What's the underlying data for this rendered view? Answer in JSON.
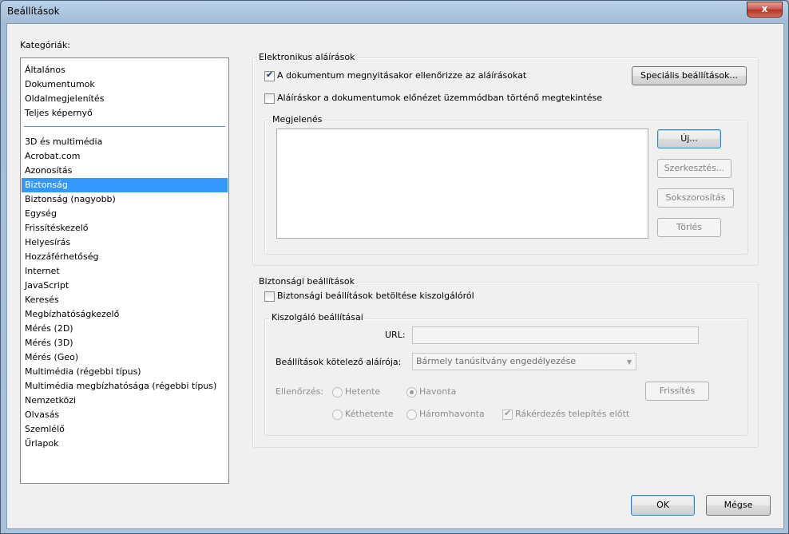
{
  "window": {
    "title": "Beállítások",
    "close_glyph": "x"
  },
  "categories": {
    "label": "Kategóriák:",
    "group1": [
      "Általános",
      "Dokumentumok",
      "Oldalmegjelenítés",
      "Teljes képernyő"
    ],
    "group2": [
      "3D és multimédia",
      "Acrobat.com",
      "Azonosítás",
      "Biztonság",
      "Biztonság (nagyobb)",
      "Egység",
      "Frissítéskezelő",
      "Helyesírás",
      "Hozzáférhetőség",
      "Internet",
      "JavaScript",
      "Keresés",
      "Megbízhatóságkezelő",
      "Mérés (2D)",
      "Mérés (3D)",
      "Mérés (Geo)",
      "Multimédia (régebbi típus)",
      "Multimédia megbízhatósága (régebbi típus)",
      "Nemzetközi",
      "Olvasás",
      "Szemlélő",
      "Űrlapok"
    ],
    "selected": "Biztonság"
  },
  "esign": {
    "legend": "Elektronikus aláírások",
    "verify_on_open": {
      "label": "A dokumentum megnyitásakor ellenőrizze az aláírásokat",
      "checked": true
    },
    "preview_mode": {
      "label": "Aláíráskor a dokumentumok előnézet üzemmódban történő megtekintése",
      "checked": false
    },
    "advanced_button": "Speciális beállítások...",
    "appearance": {
      "legend": "Megjelenés",
      "new_button": "Új...",
      "edit_button": "Szerkesztés...",
      "duplicate_button": "Sokszorosítás",
      "delete_button": "Törlés"
    }
  },
  "security": {
    "legend": "Biztonsági beállítások",
    "load_from_server": {
      "label": "Biztonsági beállítások betöltése kiszolgálóról",
      "checked": false
    },
    "server": {
      "legend": "Kiszolgáló beállításai",
      "url_label": "URL:",
      "url_value": "",
      "signer_label": "Beállítások kötelező aláírója:",
      "signer_value": "Bármely tanúsítvány engedélyezése",
      "check_label": "Ellenőrzés:",
      "options": [
        "Hetente",
        "Havonta",
        "Kéthetente",
        "Háromhavonta"
      ],
      "selected_option": "Havonta",
      "ask_before_install": {
        "label": "Rákérdezés telepítés előtt",
        "checked": true
      },
      "refresh_button": "Frissítés"
    }
  },
  "footer": {
    "ok": "OK",
    "cancel": "Mégse"
  }
}
